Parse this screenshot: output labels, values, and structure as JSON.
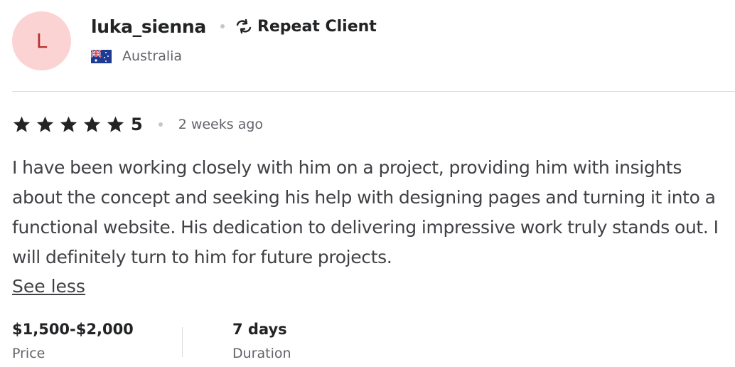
{
  "reviewer": {
    "avatar_initial": "L",
    "username": "luka_sienna",
    "badge": "Repeat Client",
    "country": "Australia"
  },
  "review": {
    "rating": "5",
    "stars_count": 5,
    "time_ago": "2 weeks ago",
    "text": "I have been working closely with him on a project, providing him with insights about the concept and seeking his help with designing pages and turning it into a functional website. His dedication to delivering impressive work truly stands out. I will definitely turn to him for future projects.",
    "toggle_label": "See less"
  },
  "meta": {
    "price_value": "$1,500-$2,000",
    "price_label": "Price",
    "duration_value": "7 days",
    "duration_label": "Duration"
  },
  "icons": {
    "star": "star-icon",
    "repeat": "repeat-icon",
    "flag": "australia-flag-icon"
  },
  "colors": {
    "avatar_bg": "#fbd3d3",
    "avatar_text": "#b83232",
    "text_primary": "#222325",
    "text_secondary": "#62646a",
    "divider": "#dadbdd"
  }
}
